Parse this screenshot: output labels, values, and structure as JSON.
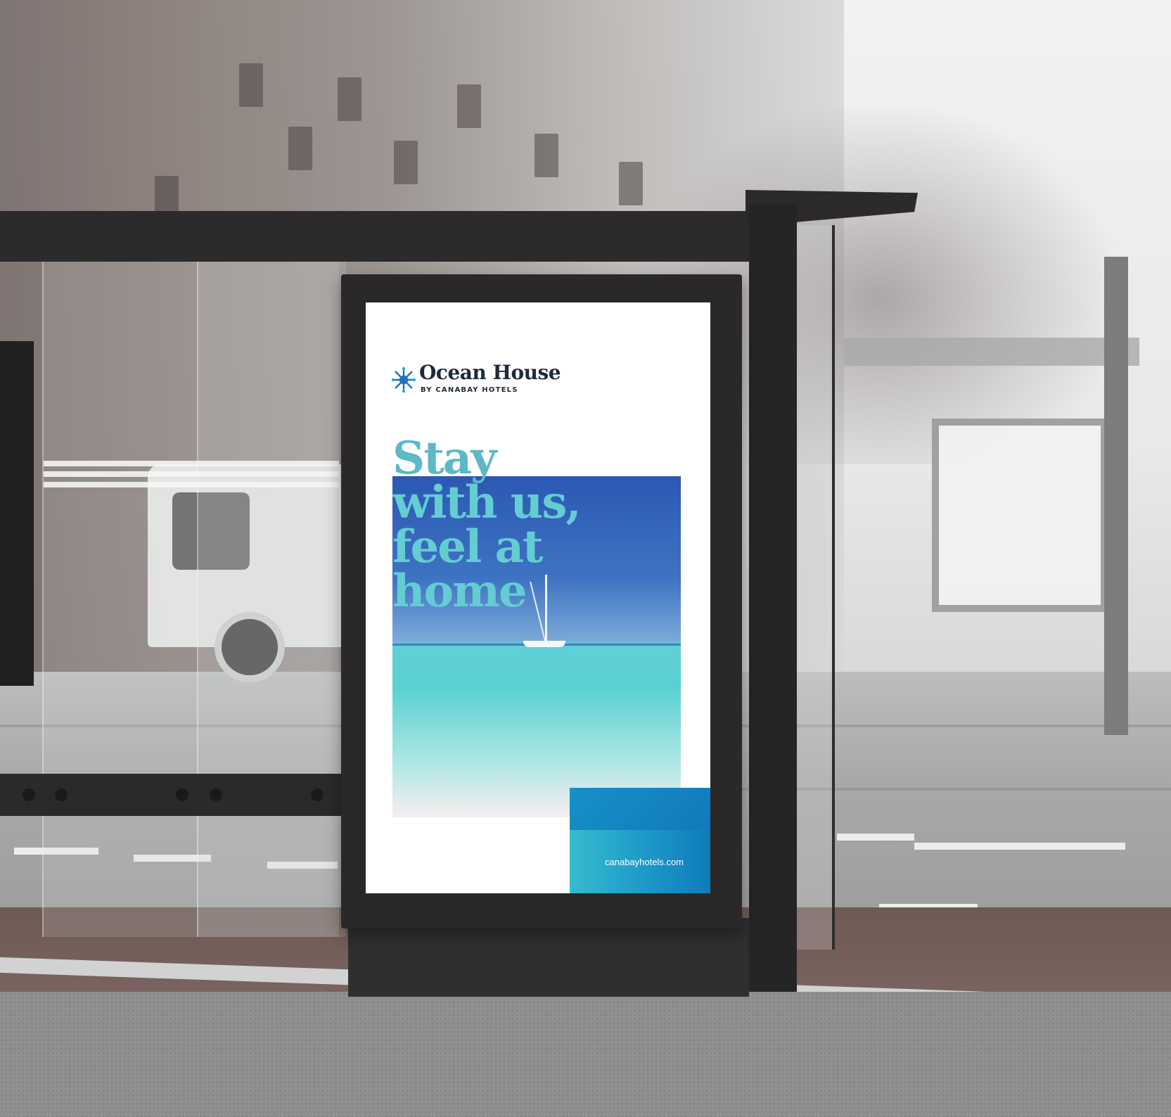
{
  "poster": {
    "brand_name": "Ocean House",
    "brand_sub": "BY CANABAY HOTELS",
    "headline": [
      "Stay",
      "with us,",
      "feel at",
      "home"
    ],
    "url": "canabayhotels.com",
    "logo_icon": "snowflake-star-icon"
  },
  "colors": {
    "brand_navy": "#1c2a3a",
    "headline_teal": "#5fc3cf",
    "cta_blue": "#0f7bb8",
    "cta_teal": "#36bcd0"
  }
}
